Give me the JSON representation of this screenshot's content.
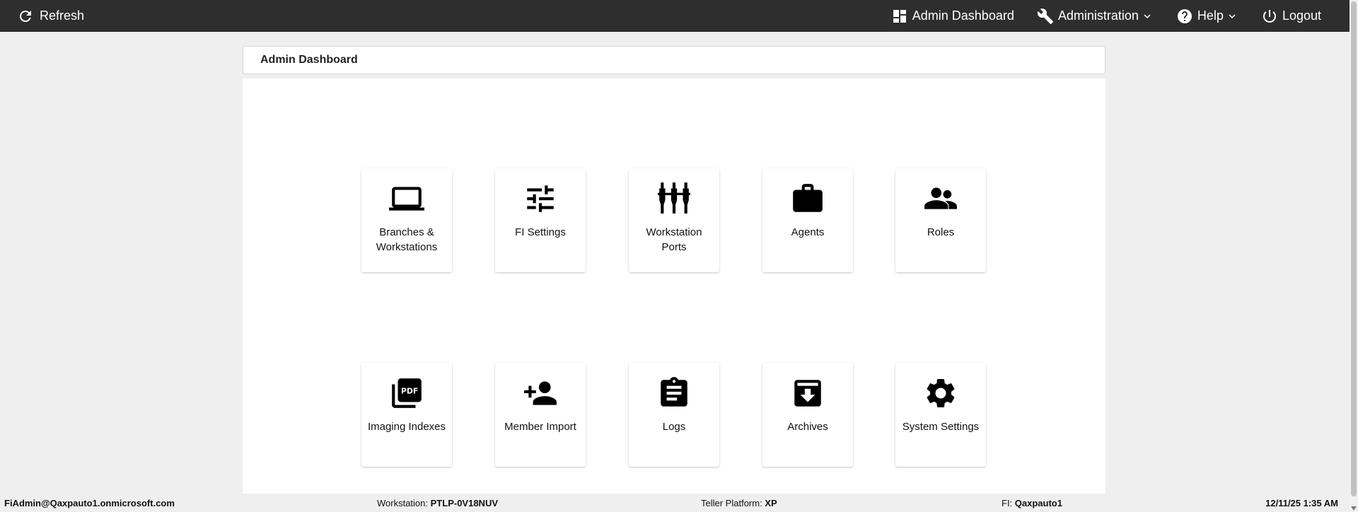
{
  "topbar": {
    "refresh_label": "Refresh",
    "nav": [
      {
        "label": "Admin Dashboard",
        "icon": "dashboard-icon"
      },
      {
        "label": "Administration",
        "icon": "wrench-icon"
      },
      {
        "label": "Help",
        "icon": "help-icon"
      },
      {
        "label": "Logout",
        "icon": "power-icon"
      }
    ]
  },
  "page_title": "Admin Dashboard",
  "tiles": [
    {
      "label": "Branches & Workstations",
      "icon": "laptop-icon"
    },
    {
      "label": "FI Settings",
      "icon": "tune-icon"
    },
    {
      "label": "Workstation Ports",
      "icon": "ports-icon"
    },
    {
      "label": "Agents",
      "icon": "briefcase-icon"
    },
    {
      "label": "Roles",
      "icon": "people-icon"
    },
    {
      "label": "Imaging Indexes",
      "icon": "pdf-icon"
    },
    {
      "label": "Member Import",
      "icon": "person-add-icon"
    },
    {
      "label": "Logs",
      "icon": "clipboard-icon"
    },
    {
      "label": "Archives",
      "icon": "archive-icon"
    },
    {
      "label": "System Settings",
      "icon": "gear-icon"
    }
  ],
  "status": {
    "user": "FiAdmin@Qaxpauto1.onmicrosoft.com",
    "workstation_label": "Workstation:",
    "workstation_value": "PTLP-0V18NUV",
    "platform_label": "Teller Platform:",
    "platform_value": "XP",
    "fi_label": "FI:",
    "fi_value": "Qaxpauto1",
    "datetime": "12/11/25 1:35 AM"
  },
  "colors": {
    "topbar_bg": "#2e2e2e",
    "page_bg": "#efefef",
    "card_bg": "#ffffff"
  }
}
